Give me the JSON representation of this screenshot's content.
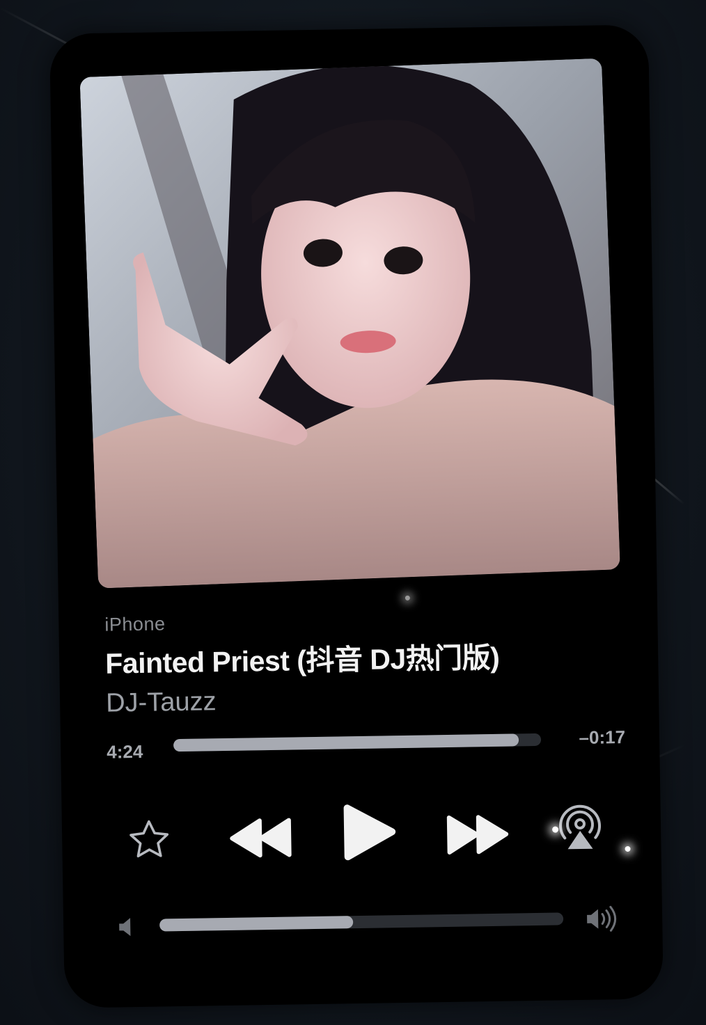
{
  "now_playing": {
    "device": "iPhone",
    "title": "Fainted Priest (抖音 DJ热门版)",
    "artist": "DJ-Tauzz"
  },
  "progress": {
    "elapsed": "4:24",
    "remaining": "–0:17",
    "fraction": 0.94
  },
  "controls": {
    "favorite_icon": "star-icon",
    "previous_icon": "rewind-icon",
    "play_icon": "play-icon",
    "next_icon": "fast-forward-icon",
    "airplay_icon": "airplay-icon"
  },
  "volume": {
    "level": 0.48,
    "low_icon": "speaker-low-icon",
    "high_icon": "speaker-high-icon"
  },
  "colors": {
    "background": "#000000",
    "title": "#f2f2f2",
    "secondary": "#9da1a7",
    "track": "#2b2e33",
    "fill": "#a7aab2"
  }
}
